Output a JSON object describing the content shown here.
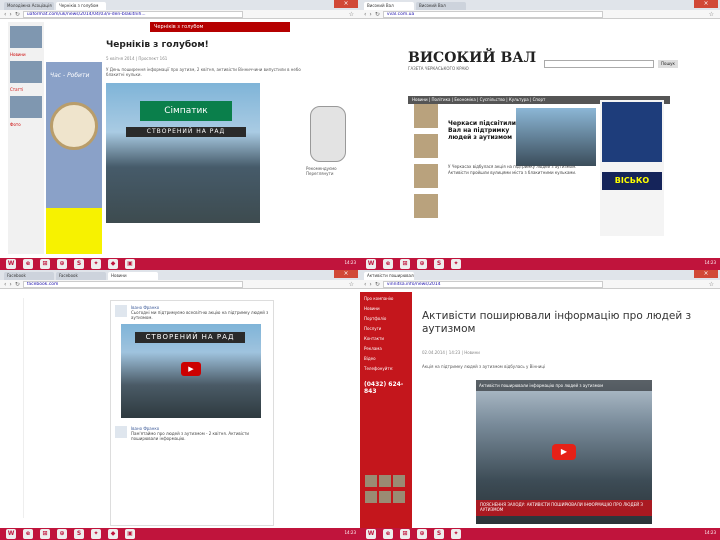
{
  "q1": {
    "tabs": [
      "Молодіжна Асоціація",
      "Черніків з голубом"
    ],
    "url": "uaformat.com/uk/news/2014/04/03/v-den-blakitnih...",
    "top_banner": "Черніків з голубом",
    "headline": "Черніків з голубом!",
    "meta": "5 квітня 2014 | Проспект 161",
    "body": "У День поширення інформації про аутизм, 2 квітня, активісти Вінниччини випустили в небо блакитні кульки.",
    "sign": "Сімпатик",
    "banner": "СТВОРЕНИЙ НА РАД",
    "ad_text": "Час - Робити",
    "left_labels": [
      "Новини",
      "Статті",
      "Фото"
    ],
    "right_text": "Рекомендуємо Переглянути"
  },
  "q2": {
    "tabs": [
      "Високий Вал",
      "Високий Вал"
    ],
    "url": "vval.com.ua",
    "logo": "ВИСОКИЙ ВАЛ",
    "logo_sub": "ГАЗЕТА ЧЕРКАСЬКОГО КРАЮ",
    "search_btn": "Пошук",
    "nav": "Новини | Політика | Економіка | Суспільство | Культура | Спорт",
    "headline": "Черкаси підсвітили Вал на підтримку людей з аутизмом",
    "text": "У Черкасах відбулася акція на підтримку людей з аутизмом. Активісти пройшли вулицями міста з блакитними кульками.",
    "bisko": "ВІСЬКО"
  },
  "q3": {
    "tabs": [
      "Facebook",
      "Facebook",
      "Новини"
    ],
    "url": "facebook.com",
    "post_name": "Івано Франко",
    "post_text": "Сьогодні ми підтримуємо всесвітню акцію на підтримку людей з аутизмом.",
    "banner": "СТВОРЕНИЙ НА РАД",
    "play": "▶",
    "footer_name": "Івано Франко",
    "footer_text": "Пам'ятаймо про людей з аутизмом - 2 квітня. Активісти поширювали інформацію."
  },
  "q4": {
    "tabs": [
      "Активісти поширювали"
    ],
    "url": "vinnitsa.info/news/2014",
    "menu": [
      "Про компанію",
      "Новини",
      "Портфоліо",
      "Послуги",
      "Контакти",
      "Реклама",
      "Відео"
    ],
    "phone_label": "Телефонуйте:",
    "phone": "(0432) 624-843",
    "title": "Активісти поширювали інформацію про людей з аутизмом",
    "meta": "02.04.2014 | 14:23 | Новини",
    "lead": "Акція на підтримку людей з аутизмом відбулась у Вінниці",
    "video_title": "Активісти поширювали інформацію про людей з аутизмом",
    "caption": "ПОЯСНЕННЯ ЗАХОДУ: АКТИВІСТИ ПОШИРЮВАЛИ ІНФОРМАЦІЮ ПРО ЛЮДЕЙ З АУТИЗМОМ",
    "play": "▶"
  },
  "taskbar": {
    "icons": [
      "W",
      "e",
      "⊞",
      "⊕",
      "S",
      "✦",
      "◆",
      "▣"
    ],
    "time": "14:23"
  },
  "colors": {
    "taskbar": "#c0143c",
    "accent_red": "#c4161c",
    "link": "#1a0dab"
  }
}
